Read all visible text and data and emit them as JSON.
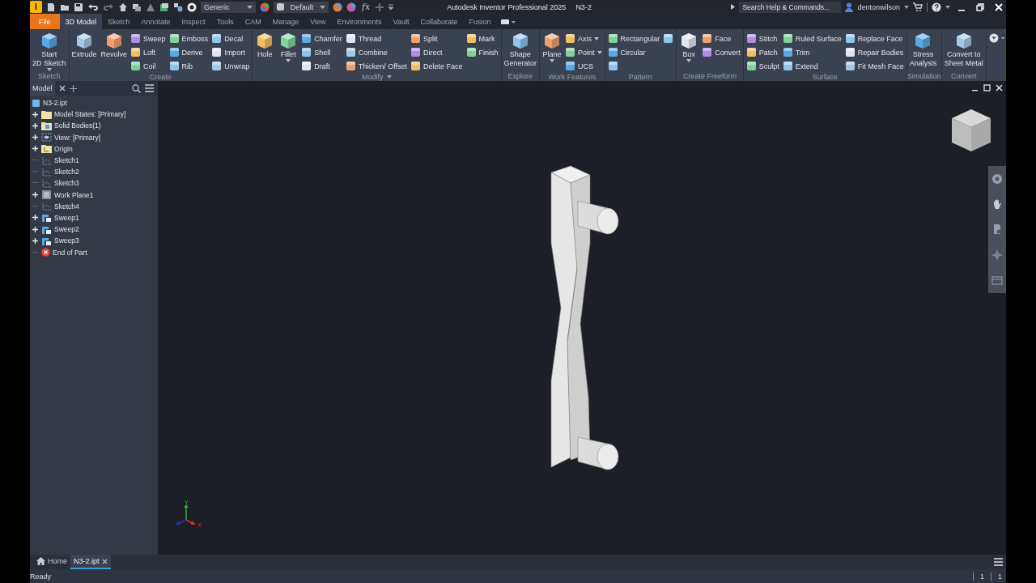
{
  "title_bar": {
    "logo": "I",
    "material": "Generic",
    "appearance": "Default",
    "formula_button": "fx",
    "title": "Autodesk Inventor Professional 2025",
    "document": "N3-2",
    "search": {
      "placeholder": "Search Help & Commands..."
    },
    "user": "dentonwilson"
  },
  "tabs": [
    {
      "label": "File",
      "kind": "file",
      "selected": false
    },
    {
      "label": "3D Model",
      "kind": "tab",
      "selected": true
    },
    {
      "label": "Sketch",
      "kind": "tab",
      "selected": false
    },
    {
      "label": "Annotate",
      "kind": "tab",
      "selected": false
    },
    {
      "label": "Inspect",
      "kind": "tab",
      "selected": false
    },
    {
      "label": "Tools",
      "kind": "tab",
      "selected": false
    },
    {
      "label": "CAM",
      "kind": "tab",
      "selected": false
    },
    {
      "label": "Manage",
      "kind": "tab",
      "selected": false
    },
    {
      "label": "View",
      "kind": "tab",
      "selected": false
    },
    {
      "label": "Environments",
      "kind": "tab",
      "selected": false
    },
    {
      "label": "Vault",
      "kind": "tab",
      "selected": false
    },
    {
      "label": "Collaborate",
      "kind": "tab",
      "selected": false
    },
    {
      "label": "Fusion",
      "kind": "tab",
      "selected": false
    }
  ],
  "ribbon": {
    "panels": [
      {
        "label": "Sketch",
        "dropdown": false,
        "columns": [
          {
            "kind": "large",
            "tools": [
              {
                "lines": [
                  "Start",
                  "2D Sketch"
                ],
                "dropdown": true
              }
            ]
          }
        ]
      },
      {
        "label": "Create",
        "dropdown": false,
        "columns": [
          {
            "kind": "large",
            "tools": [
              {
                "lines": [
                  "Extrude"
                ],
                "dropdown": false
              },
              {
                "lines": [
                  "Revolve"
                ],
                "dropdown": false
              }
            ]
          },
          {
            "kind": "small",
            "tools": [
              {
                "label": "Sweep",
                "dropdown": false
              },
              {
                "label": "Loft",
                "dropdown": false
              },
              {
                "label": "Coil",
                "dropdown": false
              }
            ]
          },
          {
            "kind": "small",
            "tools": [
              {
                "label": "Emboss",
                "dropdown": false
              },
              {
                "label": "Derive",
                "dropdown": false
              },
              {
                "label": "Rib",
                "dropdown": false
              }
            ]
          },
          {
            "kind": "small",
            "tools": [
              {
                "label": "Decal",
                "dropdown": false
              },
              {
                "label": "Import",
                "dropdown": false
              },
              {
                "label": "Unwrap",
                "dropdown": false
              }
            ]
          }
        ]
      },
      {
        "label": "Modify",
        "dropdown": true,
        "columns": [
          {
            "kind": "large",
            "tools": [
              {
                "lines": [
                  "Hole"
                ],
                "dropdown": false
              },
              {
                "lines": [
                  "Fillet"
                ],
                "dropdown": true
              }
            ]
          },
          {
            "kind": "small",
            "tools": [
              {
                "label": "Chamfer",
                "dropdown": false
              },
              {
                "label": "Shell",
                "dropdown": false
              },
              {
                "label": "Draft",
                "dropdown": false
              }
            ]
          },
          {
            "kind": "small",
            "tools": [
              {
                "label": "Thread",
                "dropdown": false
              },
              {
                "label": "Combine",
                "dropdown": false
              },
              {
                "label": "Thicken/ Offset",
                "dropdown": false
              }
            ]
          },
          {
            "kind": "small",
            "tools": [
              {
                "label": "Split",
                "dropdown": false
              },
              {
                "label": "Direct",
                "dropdown": false
              },
              {
                "label": "Delete Face",
                "dropdown": false
              }
            ]
          },
          {
            "kind": "small",
            "tools": [
              {
                "label": "Mark",
                "dropdown": false
              },
              {
                "label": "Finish",
                "dropdown": false
              }
            ]
          }
        ]
      },
      {
        "label": "Explore",
        "dropdown": false,
        "columns": [
          {
            "kind": "large",
            "tools": [
              {
                "lines": [
                  "Shape",
                  "Generator"
                ],
                "dropdown": false
              }
            ]
          }
        ]
      },
      {
        "label": "Work Features",
        "dropdown": false,
        "columns": [
          {
            "kind": "large",
            "tools": [
              {
                "lines": [
                  "Plane"
                ],
                "dropdown": true
              }
            ]
          },
          {
            "kind": "small",
            "tools": [
              {
                "label": "Axis",
                "dropdown": true
              },
              {
                "label": "Point",
                "dropdown": true
              },
              {
                "label": "UCS",
                "dropdown": false
              }
            ]
          }
        ]
      },
      {
        "label": "Pattern",
        "dropdown": false,
        "columns": [
          {
            "kind": "small",
            "tools": [
              {
                "label": "Rectangular",
                "dropdown": false
              },
              {
                "label": "Circular",
                "dropdown": false
              },
              {
                "dropdown": false
              }
            ]
          },
          {
            "kind": "small",
            "tools": [
              {
                "dropdown": false
              }
            ]
          }
        ]
      },
      {
        "label": "Create Freeform",
        "dropdown": false,
        "columns": [
          {
            "kind": "large",
            "tools": [
              {
                "lines": [
                  "Box"
                ],
                "dropdown": true
              }
            ]
          },
          {
            "kind": "small",
            "tools": [
              {
                "label": "Face",
                "dropdown": false
              },
              {
                "label": "Convert",
                "dropdown": false
              }
            ]
          }
        ]
      },
      {
        "label": "Surface",
        "dropdown": false,
        "columns": [
          {
            "kind": "small",
            "tools": [
              {
                "label": "Stitch",
                "dropdown": false
              },
              {
                "label": "Patch",
                "dropdown": false
              },
              {
                "label": "Sculpt",
                "dropdown": false
              }
            ]
          },
          {
            "kind": "small",
            "tools": [
              {
                "label": "Ruled Surface",
                "dropdown": false
              },
              {
                "label": "Trim",
                "dropdown": false
              },
              {
                "label": "Extend",
                "dropdown": false
              }
            ]
          },
          {
            "kind": "small",
            "tools": [
              {
                "label": "Replace Face",
                "dropdown": false
              },
              {
                "label": "Repair Bodies",
                "dropdown": false
              },
              {
                "label": "Fit Mesh Face",
                "dropdown": false
              }
            ]
          }
        ]
      },
      {
        "label": "Simulation",
        "dropdown": false,
        "columns": [
          {
            "kind": "large",
            "tools": [
              {
                "lines": [
                  "Stress",
                  "Analysis"
                ],
                "dropdown": false
              }
            ]
          }
        ]
      },
      {
        "label": "Convert",
        "dropdown": false,
        "columns": [
          {
            "kind": "large",
            "tools": [
              {
                "lines": [
                  "Convert to",
                  "Sheet Metal"
                ],
                "dropdown": false
              }
            ]
          }
        ]
      }
    ]
  },
  "browser": {
    "tab": "Model",
    "tree": {
      "label": "N3-2.ipt",
      "kind": "part",
      "children": [
        {
          "label": "Model States: [Primary]",
          "kind": "folder",
          "expandable": true
        },
        {
          "label": "Solid Bodies(1)",
          "kind": "bodies",
          "expandable": true
        },
        {
          "label": "View: [Primary]",
          "kind": "view",
          "expandable": true
        },
        {
          "label": "Origin",
          "kind": "origin",
          "expandable": true
        },
        {
          "label": "Sketch1",
          "kind": "sketch",
          "expandable": false
        },
        {
          "label": "Sketch2",
          "kind": "sketch",
          "expandable": false
        },
        {
          "label": "Sketch3",
          "kind": "sketch",
          "expandable": false
        },
        {
          "label": "Work Plane1",
          "kind": "workplane",
          "expandable": true
        },
        {
          "label": "Sketch4",
          "kind": "sketch",
          "expandable": false
        },
        {
          "label": "Sweep1",
          "kind": "sweep",
          "expandable": true
        },
        {
          "label": "Sweep2",
          "kind": "sweep",
          "expandable": true
        },
        {
          "label": "Sweep3",
          "kind": "sweep",
          "expandable": true
        },
        {
          "label": "End of Part",
          "kind": "end",
          "expandable": false
        }
      ]
    }
  },
  "viewport": {
    "triad": {
      "y": "Y",
      "x": "X"
    }
  },
  "document_tabs": [
    {
      "label": "Home",
      "kind": "home",
      "selected": false
    },
    {
      "label": "N3-2.ipt",
      "kind": "document",
      "selected": true
    }
  ],
  "status_bar": {
    "text": "Ready",
    "counters": [
      "1",
      "1"
    ]
  }
}
